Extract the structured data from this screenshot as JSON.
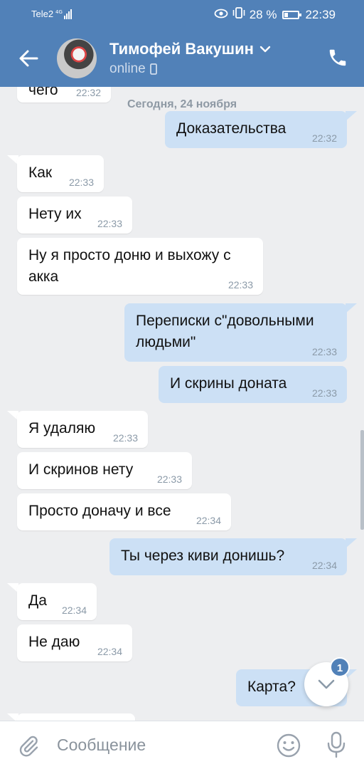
{
  "status_bar": {
    "carrier": "Tele2",
    "network": "4G",
    "battery_text": "28 %",
    "battery_level": 0.28,
    "time": "22:39"
  },
  "header": {
    "contact_name": "Тимофей Вакушин",
    "presence": "online",
    "icons": {
      "back": "arrow-left-icon",
      "dropdown": "chevron-down-icon",
      "device": "mobile-phone-icon",
      "call": "phone-icon"
    }
  },
  "chat": {
    "top_partial_message": {
      "text": "чего",
      "time": "22:32"
    },
    "date_separator": "Сегодня, 24 ноября",
    "messages": [
      {
        "dir": "out",
        "text": "Доказательства",
        "time": "22:32"
      },
      {
        "dir": "in",
        "text": "Как",
        "time": "22:33"
      },
      {
        "dir": "in",
        "text": "Нету их",
        "time": "22:33"
      },
      {
        "dir": "in",
        "text": "Ну я просто доню и выхожу с акка",
        "time": "22:33"
      },
      {
        "dir": "out",
        "text": "Переписки с\"довольными людьми\"",
        "time": "22:33"
      },
      {
        "dir": "out",
        "text": "И скрины доната",
        "time": "22:33"
      },
      {
        "dir": "in",
        "text": "Я удаляю",
        "time": "22:33"
      },
      {
        "dir": "in",
        "text": "И скринов нету",
        "time": "22:33"
      },
      {
        "dir": "in",
        "text": "Просто доначу и все",
        "time": "22:34"
      },
      {
        "dir": "out",
        "text": "Ты через киви донишь?",
        "time": "22:34"
      },
      {
        "dir": "in",
        "text": "Да",
        "time": "22:34"
      },
      {
        "dir": "in",
        "text": "Не даю",
        "time": "22:34"
      },
      {
        "dir": "out",
        "text": "Карта?",
        "time": ""
      }
    ],
    "scroll_down_badge": "1"
  },
  "composer": {
    "placeholder": "Сообщение",
    "icons": {
      "attach": "paperclip-icon",
      "emoji": "smile-icon",
      "voice": "microphone-icon"
    }
  },
  "colors": {
    "header": "#5181b8",
    "background": "#edeef0",
    "incoming_bubble": "#ffffff",
    "outgoing_bubble": "#cce0f5",
    "timestamp": "#8b9aa8"
  }
}
